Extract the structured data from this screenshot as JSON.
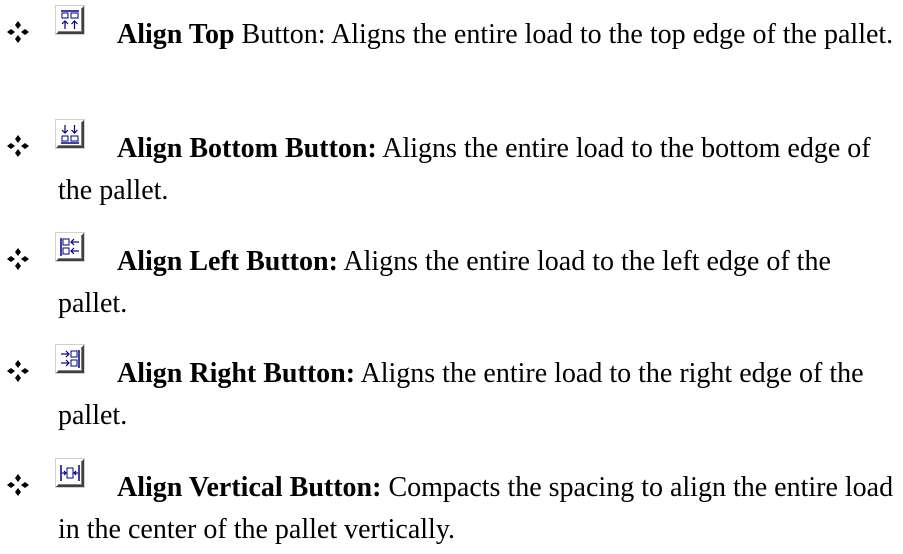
{
  "items": [
    {
      "icon": "align-top-icon",
      "title": "Align Top",
      "title_suffix": " Button:",
      "description": "  Aligns the entire load to the top edge of the pallet."
    },
    {
      "icon": "align-bottom-icon",
      "title": "Align Bottom Button:",
      "title_suffix": "",
      "description": "  Aligns the entire load to the bottom edge of the pallet."
    },
    {
      "icon": "align-left-icon",
      "title": "Align Left Button:",
      "title_suffix": "",
      "description": "  Aligns the entire load to the left edge of the pallet."
    },
    {
      "icon": "align-right-icon",
      "title": "Align Right Button:",
      "title_suffix": "",
      "description": "  Aligns the entire load to the right edge of the pallet."
    },
    {
      "icon": "align-vertical-icon",
      "title": "Align Vertical Button:",
      "title_suffix": "",
      "description": "  Compacts the spacing to align the entire load in the center of the pallet vertically."
    }
  ],
  "bullet_icon": "diamond-bullet-icon",
  "colors": {
    "text": "#000000",
    "icon_blue": "#000080",
    "background": "#ffffff"
  }
}
